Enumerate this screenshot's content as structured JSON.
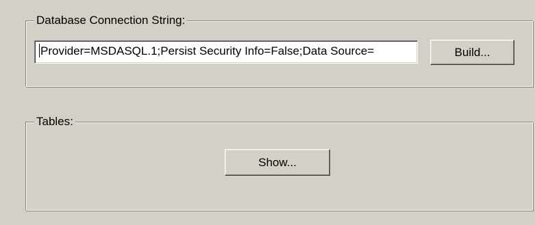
{
  "database_connection": {
    "group_label": "Database Connection String:",
    "connection_string": "Provider=MSDASQL.1;Persist Security Info=False;Data Source=",
    "build_button_label": "Build..."
  },
  "tables": {
    "group_label": "Tables:",
    "show_button_label": "Show..."
  }
}
